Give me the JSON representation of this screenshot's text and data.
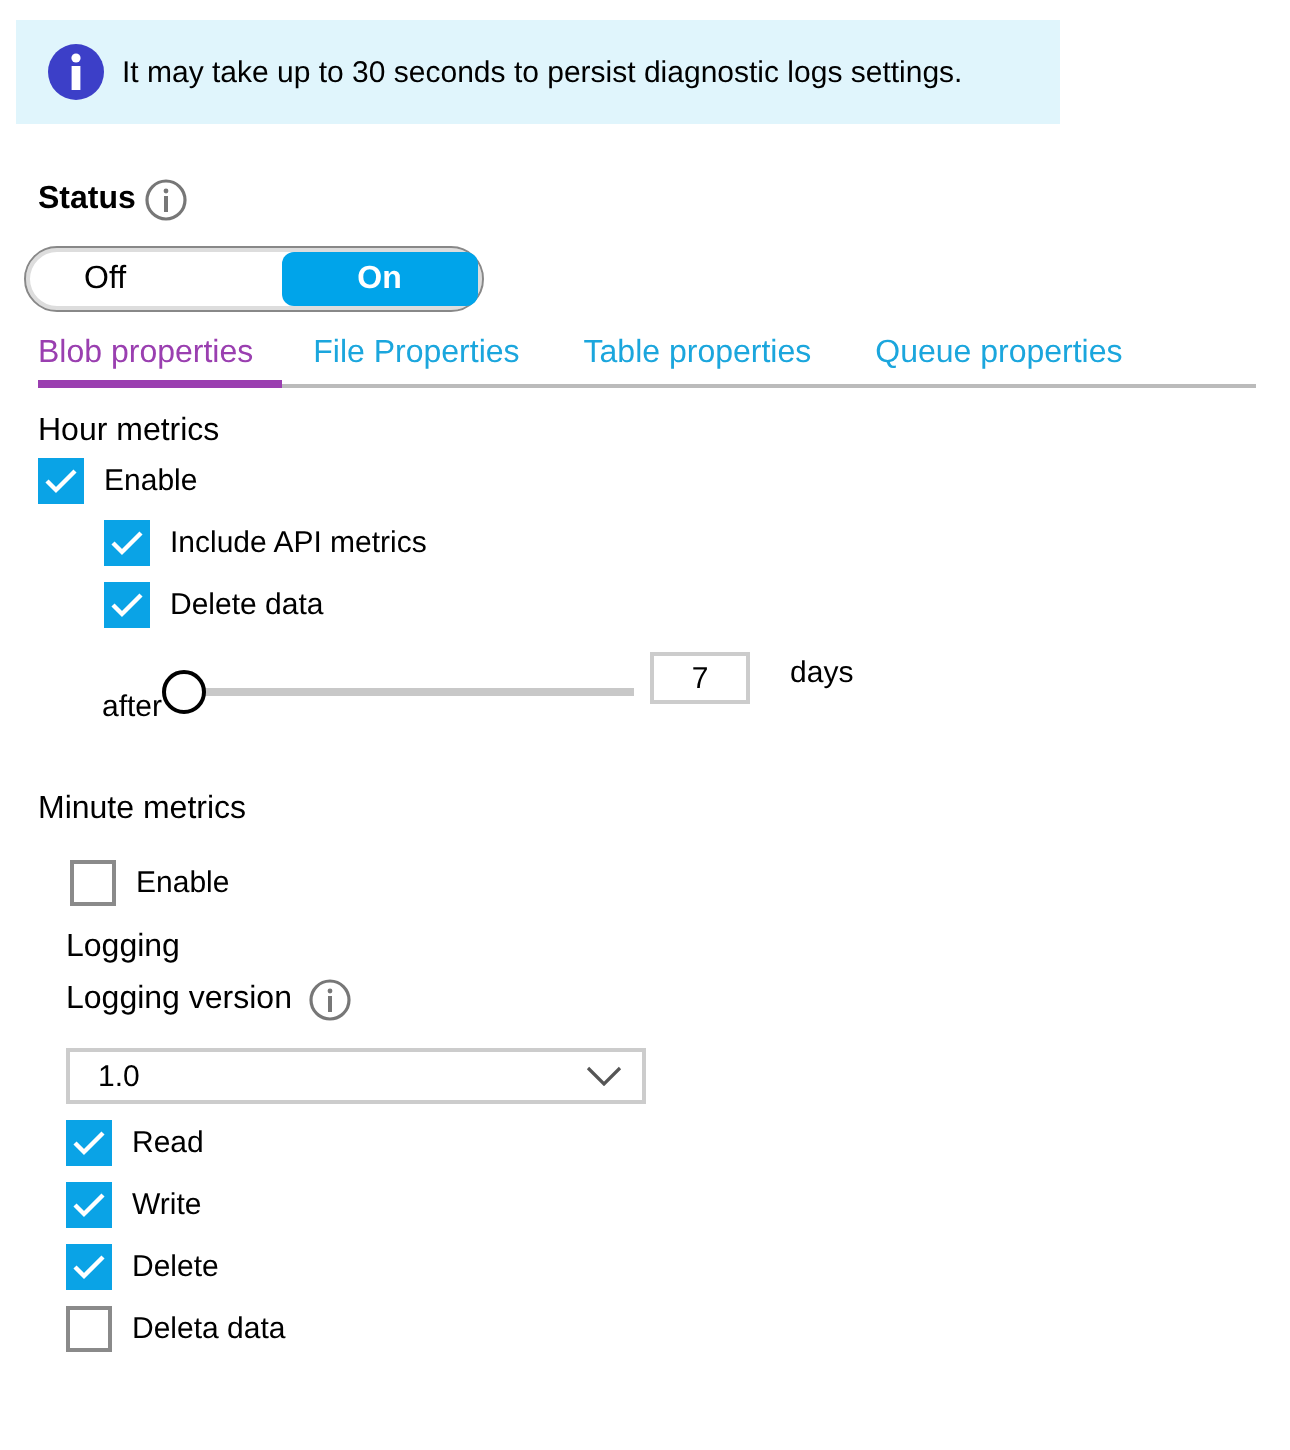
{
  "banner": {
    "text": "It may take up to 30 seconds to persist diagnostic logs settings."
  },
  "status": {
    "label": "Status",
    "options": [
      {
        "label": "Off",
        "selected": false
      },
      {
        "label": "On",
        "selected": true
      }
    ]
  },
  "tabs": [
    {
      "label": "Blob properties",
      "selected": true
    },
    {
      "label": "File Properties",
      "selected": false
    },
    {
      "label": "Table properties",
      "selected": false
    },
    {
      "label": "Queue properties",
      "selected": false
    }
  ],
  "hour_metrics": {
    "title": "Hour metrics",
    "checkboxes": [
      {
        "label": "Enable",
        "checked": true,
        "children": [
          {
            "label": "Include API metrics",
            "checked": true
          },
          {
            "label": "Delete data",
            "checked": true
          }
        ]
      }
    ],
    "retention": {
      "prefix": "after",
      "level": 0,
      "value": "7",
      "suffix": "days"
    }
  },
  "minute_metrics": {
    "title": "Minute metrics",
    "checkboxes": [
      {
        "label": "Enable",
        "checked": false
      }
    ]
  },
  "logging": {
    "title": "Logging",
    "version_label": "Logging version",
    "version": "1.0",
    "checkboxes": [
      {
        "label": "Read",
        "checked": true
      },
      {
        "label": "Write",
        "checked": true
      },
      {
        "label": "Delete",
        "checked": true
      },
      {
        "label": "Deleta data",
        "checked": false
      }
    ]
  }
}
